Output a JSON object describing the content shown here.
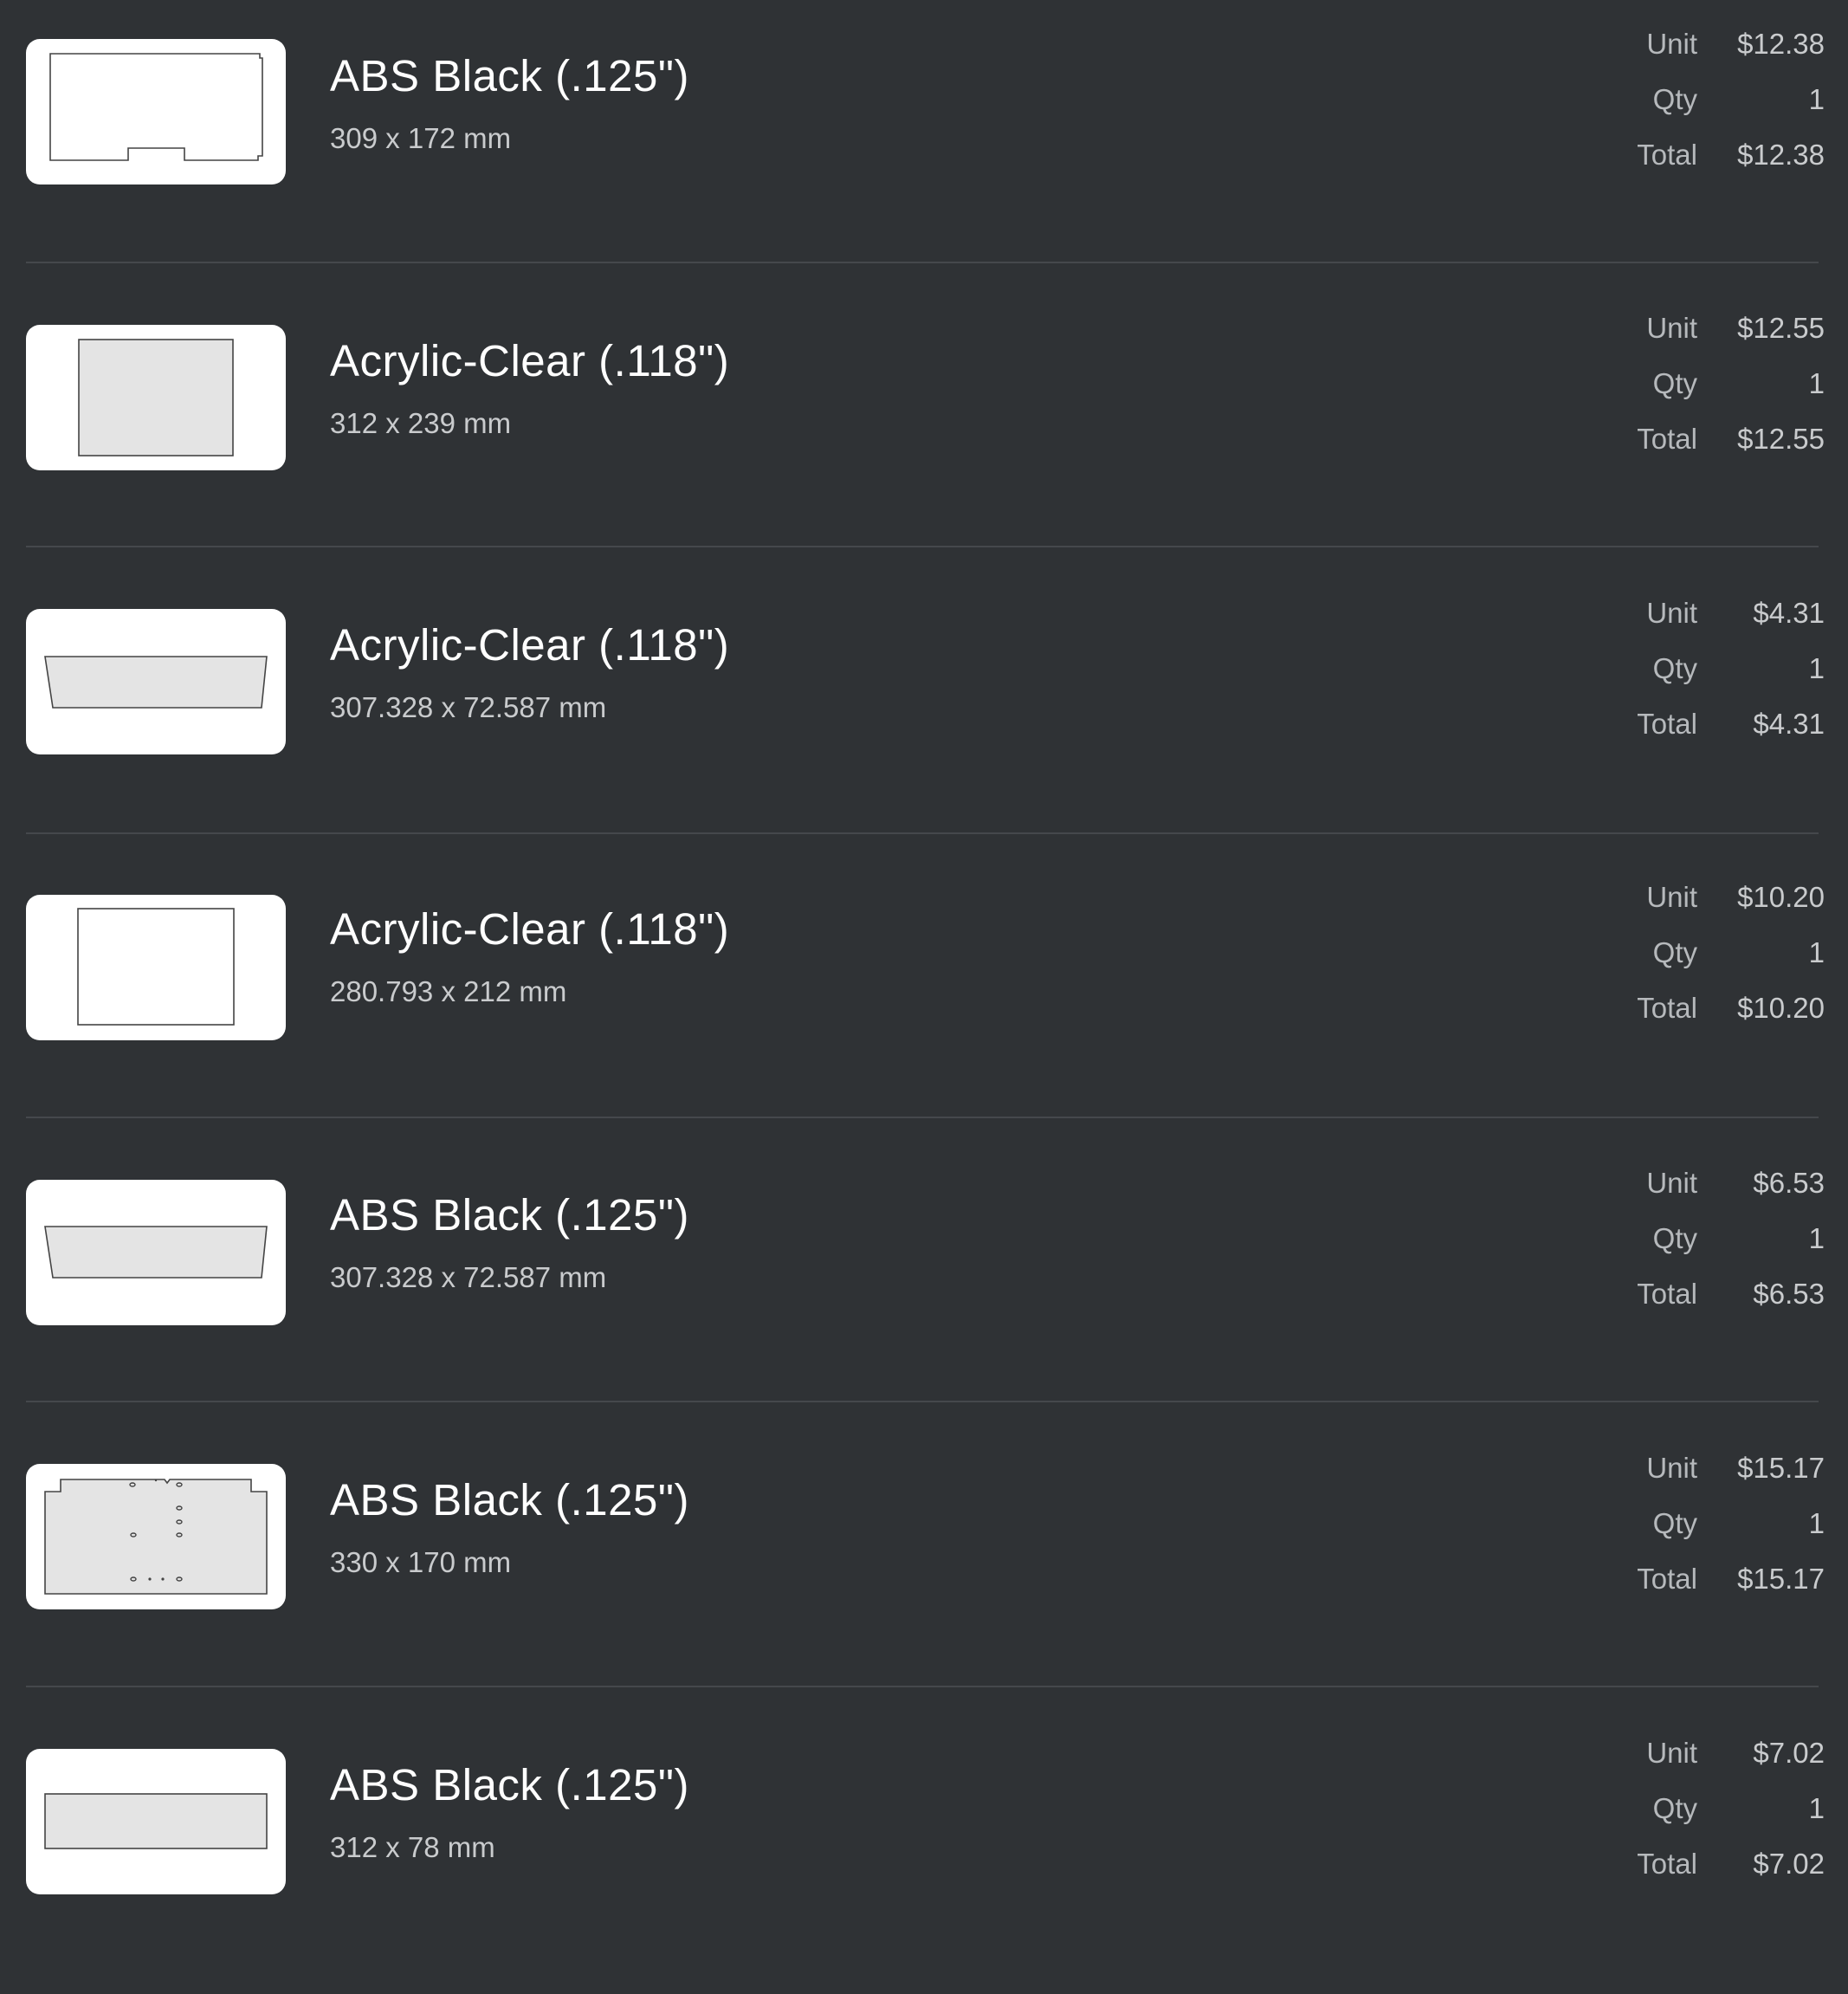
{
  "labels": {
    "unit": "Unit",
    "qty": "Qty",
    "total": "Total"
  },
  "colors": {
    "background": "#2f3235",
    "card": "#ffffff",
    "part_fill": "#e4e4e4",
    "part_stroke": "#444444"
  },
  "items": [
    {
      "name": "ABS Black (.125\")",
      "dims": "309 x 172 mm",
      "unit": "$12.38",
      "qty": "1",
      "total": "$12.38",
      "shape": "notched-outline"
    },
    {
      "name": "Acrylic-Clear (.118\")",
      "dims": "312 x 239 mm",
      "unit": "$12.55",
      "qty": "1",
      "total": "$12.55",
      "shape": "filled-rectangle"
    },
    {
      "name": "Acrylic-Clear (.118\")",
      "dims": "307.328 x 72.587 mm",
      "unit": "$4.31",
      "qty": "1",
      "total": "$4.31",
      "shape": "trapezoid"
    },
    {
      "name": "Acrylic-Clear (.118\")",
      "dims": "280.793 x 212 mm",
      "unit": "$10.20",
      "qty": "1",
      "total": "$10.20",
      "shape": "outline-rectangle"
    },
    {
      "name": "ABS Black (.125\")",
      "dims": "307.328 x 72.587 mm",
      "unit": "$6.53",
      "qty": "1",
      "total": "$6.53",
      "shape": "trapezoid"
    },
    {
      "name": "ABS Black (.125\")",
      "dims": "330 x 170 mm",
      "unit": "$15.17",
      "qty": "1",
      "total": "$15.17",
      "shape": "plate-with-holes"
    },
    {
      "name": "ABS Black (.125\")",
      "dims": "312 x 78 mm",
      "unit": "$7.02",
      "qty": "1",
      "total": "$7.02",
      "shape": "flat-bar"
    }
  ]
}
